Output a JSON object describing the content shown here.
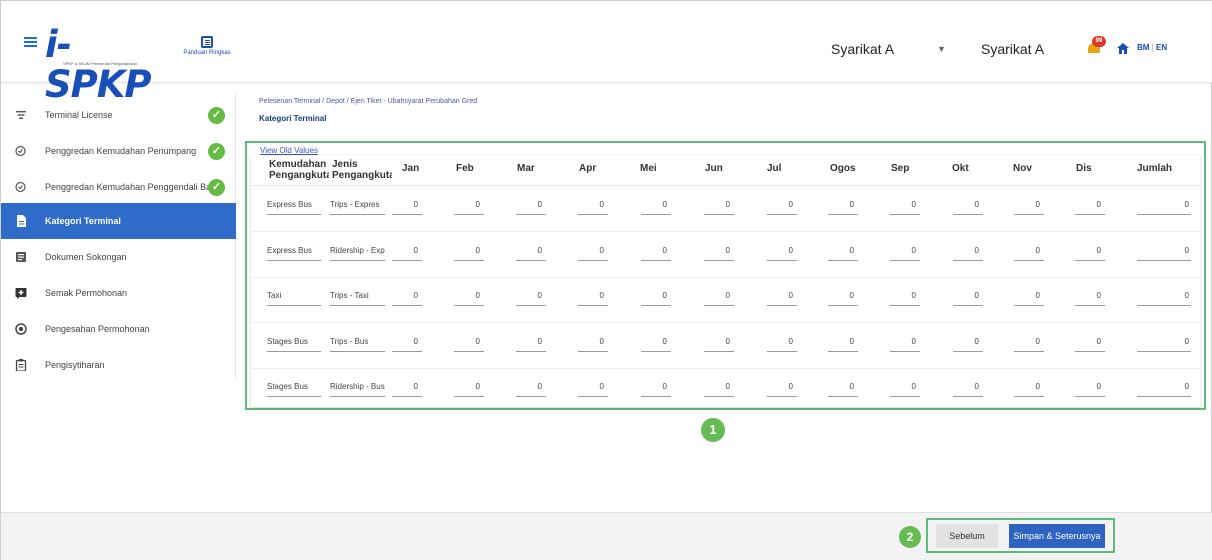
{
  "header": {
    "logo_text": "i-SPKP",
    "logo_subtext": "SPKP & SKUM Pelesenan Pengangkutan",
    "guide_label": "Panduan Ringkas",
    "company_primary": "Syarikat A",
    "company_secondary": "Syarikat A",
    "notification_count": "99",
    "lang_bm": "BM",
    "lang_separator": "|",
    "lang_en": "EN"
  },
  "sidebar": {
    "items": [
      {
        "label": "Terminal License",
        "icon": "filter-icon",
        "completed": true
      },
      {
        "label": "Penggredan Kemudahan Penumpang",
        "icon": "grade-check-icon",
        "completed": true
      },
      {
        "label": "Penggredan Kemudahan Penggendali Bas",
        "icon": "grade-check-icon",
        "completed": true
      },
      {
        "label": "Kategori Terminal",
        "icon": "document-icon",
        "active": true
      },
      {
        "label": "Dokumen Sokongan",
        "icon": "folder-doc-icon"
      },
      {
        "label": "Semak Permohonan",
        "icon": "review-icon"
      },
      {
        "label": "Pengesahan Permohonan",
        "icon": "verify-icon"
      },
      {
        "label": "Pengisytiharan",
        "icon": "clipboard-icon"
      }
    ]
  },
  "breadcrumb": "Pelesenan Terminal / Depot / Ejen Tiket - Ubahsyarat Perubahan Gred",
  "page_title": "Kategori Terminal",
  "view_old_values": "View Old Values",
  "table": {
    "columns": [
      "Kemudahan Pengangkutan",
      "Jenis Pengangkutan",
      "Jan",
      "Feb",
      "Mar",
      "Apr",
      "Mei",
      "Jun",
      "Jul",
      "Ogos",
      "Sep",
      "Okt",
      "Nov",
      "Dis",
      "Jumlah"
    ],
    "column_display": [
      "Kemudahan\nPengangkutai",
      "Jenis\nPengangkutai"
    ],
    "rows": [
      {
        "kemudahan": "Express Bus",
        "jenis": "Trips - Expres",
        "values": [
          "0",
          "0",
          "0",
          "0",
          "0",
          "0",
          "0",
          "0",
          "0",
          "0",
          "0",
          "0"
        ],
        "jumlah": "0"
      },
      {
        "kemudahan": "Express Bus",
        "jenis": "Ridership - Exp",
        "values": [
          "0",
          "0",
          "0",
          "0",
          "0",
          "0",
          "0",
          "0",
          "0",
          "0",
          "0",
          "0"
        ],
        "jumlah": "0"
      },
      {
        "kemudahan": "Taxi",
        "jenis": "Trips - Taxi",
        "values": [
          "0",
          "0",
          "0",
          "0",
          "0",
          "0",
          "0",
          "0",
          "0",
          "0",
          "0",
          "0"
        ],
        "jumlah": "0"
      },
      {
        "kemudahan": "Stages Bus",
        "jenis": "Trips - Bus",
        "values": [
          "0",
          "0",
          "0",
          "0",
          "0",
          "0",
          "0",
          "0",
          "0",
          "0",
          "0",
          "0"
        ],
        "jumlah": "0"
      },
      {
        "kemudahan": "Stages Bus",
        "jenis": "Ridership - Bus",
        "values": [
          "0",
          "0",
          "0",
          "0",
          "0",
          "0",
          "0",
          "0",
          "0",
          "0",
          "0",
          "0"
        ],
        "jumlah": "0"
      }
    ]
  },
  "annotations": {
    "marker_1": "1",
    "marker_2": "2"
  },
  "footer": {
    "prev_label": "Sebelum",
    "next_label": "Simpan & Seterusnya"
  },
  "colors": {
    "accent": "#2f6cc9",
    "success": "#66bb44",
    "highlight": "#5fba7d",
    "badge": "#d93b2b"
  }
}
